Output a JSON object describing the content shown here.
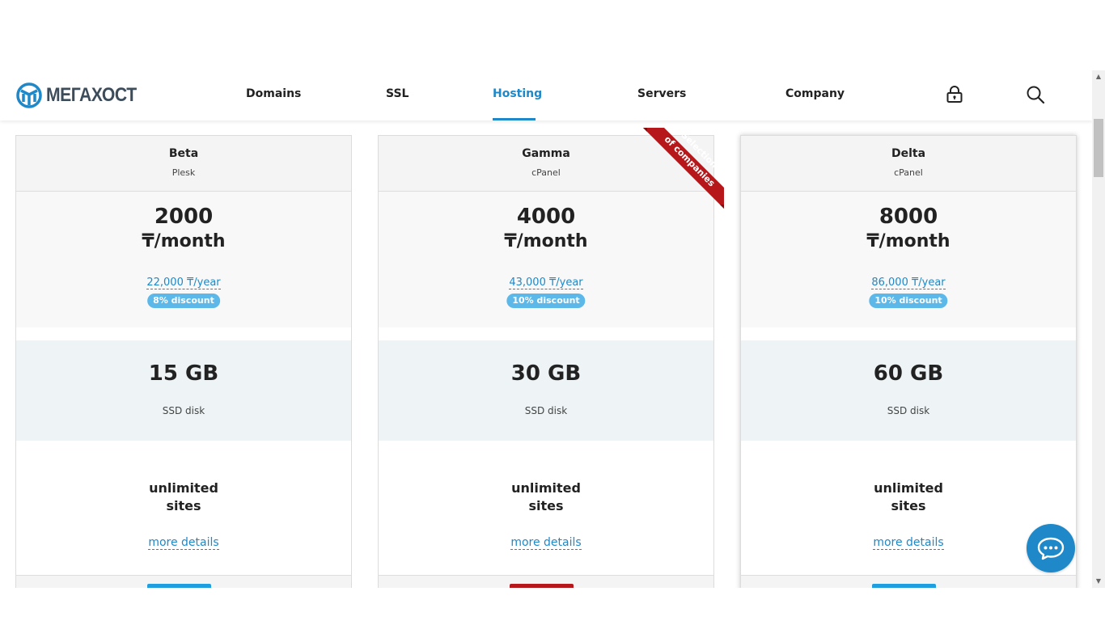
{
  "brand": {
    "name": "МЕГАХОСТ",
    "logo_color": "#1e88c8"
  },
  "nav": {
    "items": [
      {
        "label": "Domains",
        "active": false
      },
      {
        "label": "SSL",
        "active": false
      },
      {
        "label": "Hosting",
        "active": true
      },
      {
        "label": "Servers",
        "active": false
      },
      {
        "label": "Company",
        "active": false
      }
    ],
    "lock_icon": "lock-icon",
    "search_icon": "search-icon"
  },
  "ribbon": {
    "line1": "Selection",
    "line2": "of companies",
    "color": "#b5171b"
  },
  "plans": [
    {
      "name": "Beta",
      "panel": "Plesk",
      "price": "2000",
      "period": "₸/month",
      "yearly": "22,000 ₸/year",
      "discount": "8% discount",
      "disk": "15 GB",
      "disk_label": "SSD disk",
      "sites_line1": "unlimited",
      "sites_line2": "sites",
      "more": "more details"
    },
    {
      "name": "Gamma",
      "panel": "cPanel",
      "price": "4000",
      "period": "₸/month",
      "yearly": "43,000 ₸/year",
      "discount": "10% discount",
      "disk": "30 GB",
      "disk_label": "SSD disk",
      "sites_line1": "unlimited",
      "sites_line2": "sites",
      "more": "more details"
    },
    {
      "name": "Delta",
      "panel": "cPanel",
      "price": "8000",
      "period": "₸/month",
      "yearly": "86,000 ₸/year",
      "discount": "10% discount",
      "disk": "60 GB",
      "disk_label": "SSD disk",
      "sites_line1": "unlimited",
      "sites_line2": "sites",
      "more": "more details"
    }
  ],
  "colors": {
    "accent": "#1e88c8",
    "discount_badge": "#5bb8e8",
    "order_button": "#1ea0e0",
    "featured_button": "#b5171b"
  },
  "chat_icon": "chat-bubble-icon"
}
